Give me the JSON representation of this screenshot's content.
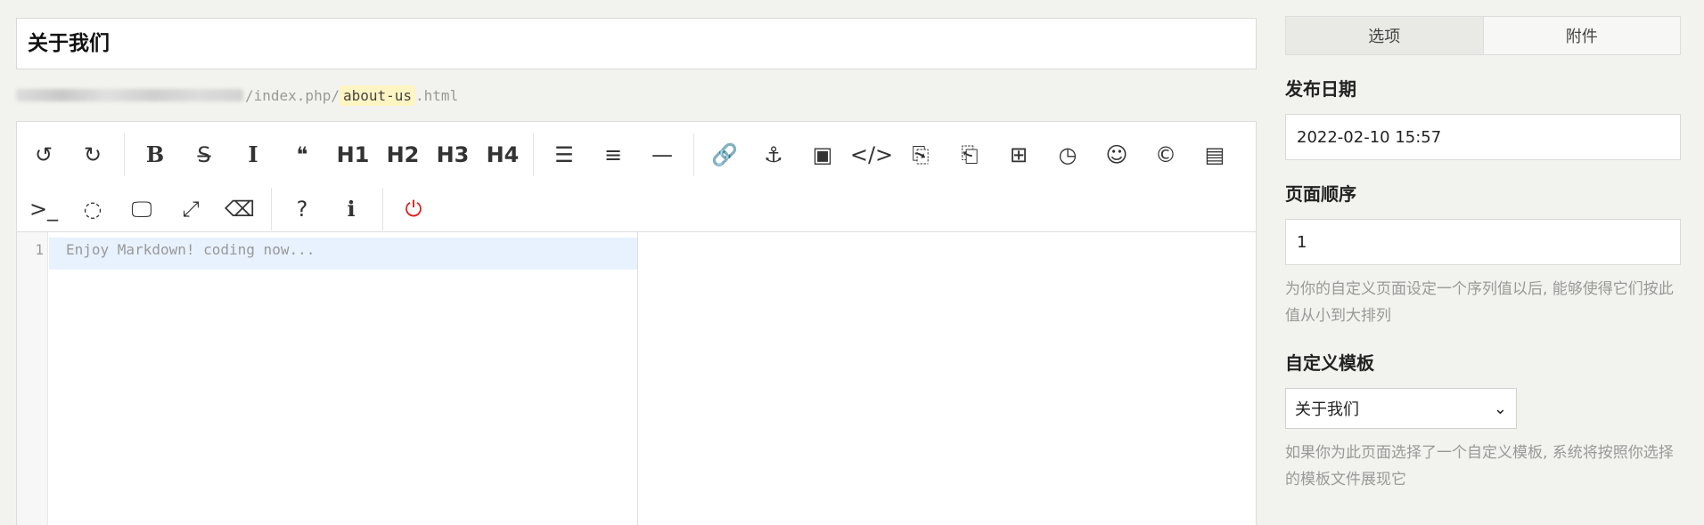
{
  "title": {
    "value": "关于我们"
  },
  "slug": {
    "prefix": "/index.php/",
    "value": "about-us",
    "suffix": ".html"
  },
  "toolbar": {
    "row1": [
      {
        "name": "undo-icon",
        "glyph": "↺"
      },
      {
        "name": "redo-icon",
        "glyph": "↻"
      },
      {
        "sep": true
      },
      {
        "name": "bold-icon",
        "glyph": "B",
        "cls": "serif"
      },
      {
        "name": "strikethrough-icon",
        "glyph": "S̶"
      },
      {
        "name": "italic-icon",
        "glyph": "I",
        "cls": "serif"
      },
      {
        "name": "quote-icon",
        "glyph": "❝"
      },
      {
        "name": "h1-button",
        "glyph": "H1",
        "cls": "h"
      },
      {
        "name": "h2-button",
        "glyph": "H2",
        "cls": "h"
      },
      {
        "name": "h3-button",
        "glyph": "H3",
        "cls": "h"
      },
      {
        "name": "h4-button",
        "glyph": "H4",
        "cls": "h"
      },
      {
        "sep": true
      },
      {
        "name": "unordered-list-icon",
        "glyph": "☰"
      },
      {
        "name": "ordered-list-icon",
        "glyph": "≡"
      },
      {
        "name": "horizontal-rule-icon",
        "glyph": "—"
      },
      {
        "sep": true
      },
      {
        "name": "link-icon",
        "glyph": "🔗"
      },
      {
        "name": "anchor-icon",
        "glyph": "⚓"
      },
      {
        "name": "image-icon",
        "glyph": "▣"
      },
      {
        "name": "code-icon",
        "glyph": "</>"
      },
      {
        "name": "code-block-icon",
        "glyph": "⎘"
      },
      {
        "name": "code-file-icon",
        "glyph": "⎗"
      },
      {
        "name": "table-icon",
        "glyph": "⊞"
      },
      {
        "name": "datetime-icon",
        "glyph": "◷"
      },
      {
        "name": "emoji-icon",
        "glyph": "☺"
      },
      {
        "name": "html-entities-icon",
        "glyph": "©"
      },
      {
        "name": "pagebreak-icon",
        "glyph": "▤"
      }
    ],
    "row2": [
      {
        "name": "terminal-icon",
        "glyph": ">_"
      },
      {
        "name": "watch-toggle-icon",
        "glyph": "◌"
      },
      {
        "name": "preview-icon",
        "glyph": "🖵"
      },
      {
        "name": "fullscreen-icon",
        "glyph": "⤢"
      },
      {
        "name": "clear-icon",
        "glyph": "⌫"
      },
      {
        "sep": true
      },
      {
        "name": "help-icon",
        "glyph": "?"
      },
      {
        "name": "info-icon",
        "glyph": "ℹ"
      },
      {
        "sep": true
      },
      {
        "name": "power-icon",
        "glyph": "⏻",
        "cls": "red"
      }
    ]
  },
  "editor": {
    "line_number": "1",
    "content": "Enjoy Markdown! coding now..."
  },
  "sidebar": {
    "tabs": [
      {
        "label": "选项",
        "active": true
      },
      {
        "label": "附件",
        "active": false
      }
    ],
    "publish_date": {
      "label": "发布日期",
      "value": "2022-02-10 15:57"
    },
    "page_order": {
      "label": "页面顺序",
      "value": "1",
      "help": "为你的自定义页面设定一个序列值以后, 能够使得它们按此值从小到大排列"
    },
    "template": {
      "label": "自定义模板",
      "selected": "关于我们",
      "help": "如果你为此页面选择了一个自定义模板, 系统将按照你选择的模板文件展现它"
    }
  }
}
